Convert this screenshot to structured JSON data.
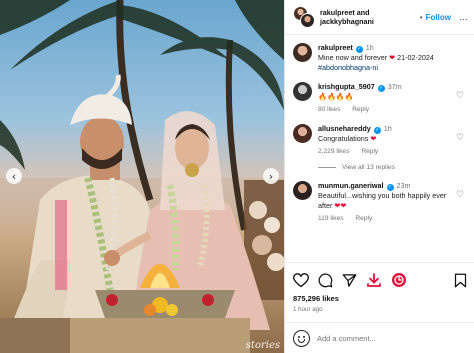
{
  "post": {
    "header": {
      "author_line1": "rakulpreet and",
      "author_line2": "jackkybhagnani",
      "follow_label": "Follow",
      "dot": "•",
      "more": "..."
    },
    "media": {
      "watermark": "stories",
      "prev_arrow": "‹",
      "next_arrow": "›"
    },
    "caption": {
      "username": "rakulpreet",
      "time": "1h",
      "text_before_emoji": "Mine now and forever",
      "date_text": "21-02-2024",
      "hashtag": "#abdonobhagna-ni"
    },
    "comments": [
      {
        "username": "krishgupta_5907",
        "verified": true,
        "time": "37m",
        "text": "🔥🔥🔥🔥",
        "likes": "80 likes",
        "reply": "Reply"
      },
      {
        "username": "allusnehareddy",
        "verified": true,
        "time": "1h",
        "text": "Congratulations",
        "likes": "2,229 likes",
        "reply": "Reply"
      },
      {
        "username": "munmun.ganeriwal",
        "verified": true,
        "time": "23m",
        "text": "Beautiful...wishing you both happily ever after",
        "likes": "119 likes",
        "reply": "Reply"
      }
    ],
    "view_all_replies": "View all 13 replies",
    "actions": {
      "like_count": "875,296 likes",
      "posted_ago": "1 hour ago"
    },
    "add_comment": {
      "placeholder": "Add a comment..."
    },
    "colors": {
      "accent": "#0095f6",
      "heart_red": "#e0103a",
      "muted": "#737373"
    },
    "icons": [
      "heart-icon",
      "comment-icon",
      "share-icon",
      "download-icon",
      "sticker-icon",
      "bookmark-icon",
      "emoji-icon",
      "verified-icon"
    ]
  }
}
